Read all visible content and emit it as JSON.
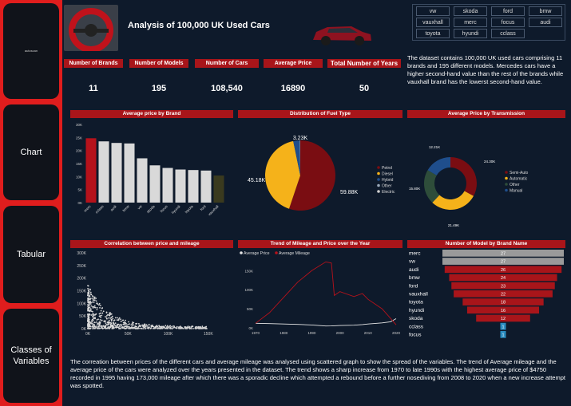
{
  "sidebar": {
    "logo_text": "autoscan",
    "items": [
      {
        "label": "Chart"
      },
      {
        "label": "Tabular"
      },
      {
        "label": "Classes of Variables"
      }
    ]
  },
  "header": {
    "title": "Analysis of 100,000 UK Used Cars"
  },
  "filters": [
    "vw",
    "skoda",
    "ford",
    "bmw",
    "vauxhall",
    "merc",
    "focus",
    "audi",
    "toyota",
    "hyundi",
    "cclass"
  ],
  "kpis": [
    {
      "label": "Number of Brands",
      "value": "11"
    },
    {
      "label": "Number of Models",
      "value": "195"
    },
    {
      "label": "Number of Cars",
      "value": "108,540"
    },
    {
      "label": "Average Price",
      "value": "16890"
    },
    {
      "label": "Total Number of Years",
      "value": "50"
    }
  ],
  "description": "The dataset contains 100,000 UK used cars comprising 11 brands and 195 different models. Mercedes cars have a higher second-hand value than the rest of the brands while vauxhall brand has the lowerst second-hand value.",
  "bottom_text": "The correation between prices of the different cars and average mileage was analysed using scattered graph to show the spread of the variables. The trend of Average mileage and the average price of the cars were analyzed over the years presented in the dataset.  The trend shows a sharp increase from 1970 to late 1990s with the highest average price of $4750 recorded in 1995 having 173,000 mileage after which there was a sporadic decline which attempted a rebound before a further nosediving from 2008 to 2020 when  a new increase attempt was spotted.",
  "colors": {
    "accent": "#a8151a",
    "background": "#0e1a2b",
    "sidebar": "#e01d1d"
  },
  "chart_data": [
    {
      "type": "bar",
      "title": "Average price by Brand",
      "categories": [
        "merc",
        "cclass",
        "audi",
        "bmw",
        "vw",
        "skoda",
        "focus",
        "hyundi",
        "toyota",
        "ford",
        "vauxhall"
      ],
      "values": [
        24700,
        23500,
        22900,
        22700,
        17000,
        14300,
        13300,
        12700,
        12500,
        12300,
        10400
      ],
      "yticks": [
        "0K",
        "5K",
        "10K",
        "15K",
        "20K",
        "25K",
        "30K"
      ],
      "ylim": [
        0,
        30000
      ],
      "colors": [
        "#b5121b",
        "#d9d9d9",
        "#d9d9d9",
        "#d9d9d9",
        "#d9d9d9",
        "#d9d9d9",
        "#d9d9d9",
        "#d9d9d9",
        "#d9d9d9",
        "#d9d9d9",
        "#3a3a1e"
      ]
    },
    {
      "type": "pie",
      "title": "Distribution of Fuel Type",
      "slices": [
        {
          "name": "Petrol",
          "value": 59.88,
          "label": "59.88K",
          "color": "#7a0d12"
        },
        {
          "name": "Diesel",
          "value": 45.18,
          "label": "45.18K",
          "color": "#f5b21a"
        },
        {
          "name": "Hybrid",
          "value": 3.23,
          "label": "3.23K",
          "color": "#1f4e8c"
        },
        {
          "name": "Other",
          "value": 0.25,
          "label": "",
          "color": "#9aa8b8"
        },
        {
          "name": "Electric",
          "value": 0.01,
          "label": "",
          "color": "#d0d0d0"
        }
      ],
      "legend_position": "right"
    },
    {
      "type": "pie",
      "title": "Average Price by Transmission",
      "donut": true,
      "slices": [
        {
          "name": "Semi-Auto",
          "value": 24.3,
          "label": "24.30K",
          "color": "#7a0d12"
        },
        {
          "name": "Automatic",
          "value": 21.49,
          "label": "21.49K",
          "color": "#f5b21a"
        },
        {
          "name": "Other",
          "value": 15.8,
          "label": "15.80K",
          "color": "#2e4d3a"
        },
        {
          "name": "Manual",
          "value": 12.21,
          "label": "12.21K",
          "color": "#1f4e8c"
        }
      ],
      "legend_position": "right"
    },
    {
      "type": "scatter",
      "title": "Correlation between price and mileage",
      "xticks": [
        "0K",
        "50K",
        "100K",
        "150K"
      ],
      "yticks": [
        "0K",
        "50K",
        "100K",
        "150K",
        "200K",
        "250K",
        "300K"
      ],
      "xlim": [
        0,
        175000
      ],
      "ylim": [
        0,
        300000
      ]
    },
    {
      "type": "line",
      "title": "Trend of Mileage and Price over the Year",
      "series": [
        {
          "name": "Average Price",
          "color": "#e6e6e6",
          "x": [
            1970,
            1975,
            1980,
            1985,
            1990,
            1995,
            1997,
            1998,
            2000,
            2005,
            2008,
            2010,
            2015,
            2018,
            2020
          ],
          "values": [
            12000,
            11000,
            10000,
            9000,
            7500,
            4750,
            5000,
            5500,
            6000,
            7000,
            8500,
            10000,
            13000,
            16000,
            24000
          ]
        },
        {
          "name": "Average Mileage",
          "color": "#b5121b",
          "x": [
            1970,
            1975,
            1980,
            1985,
            1990,
            1995,
            1997,
            1998,
            2000,
            2005,
            2008,
            2010,
            2015,
            2018,
            2020
          ],
          "values": [
            12000,
            40000,
            80000,
            120000,
            150000,
            173000,
            170000,
            85000,
            95000,
            82000,
            90000,
            75000,
            50000,
            25000,
            8000
          ]
        }
      ],
      "xticks": [
        "1970",
        "1980",
        "1990",
        "2000",
        "2010",
        "2020"
      ],
      "yticks": [
        "0K",
        "50K",
        "100K",
        "150K"
      ],
      "xlim": [
        1970,
        2020
      ],
      "ylim": [
        0,
        180000
      ]
    },
    {
      "type": "bar",
      "title": "Number of Model by Brand Name",
      "orientation": "funnel",
      "categories": [
        "merc",
        "vw",
        "audi",
        "bmw",
        "ford",
        "vauxhall",
        "toyota",
        "hyundi",
        "skoda",
        "cclass",
        "focus"
      ],
      "values": [
        27,
        27,
        26,
        24,
        23,
        22,
        18,
        16,
        12,
        1,
        1
      ]
    }
  ]
}
